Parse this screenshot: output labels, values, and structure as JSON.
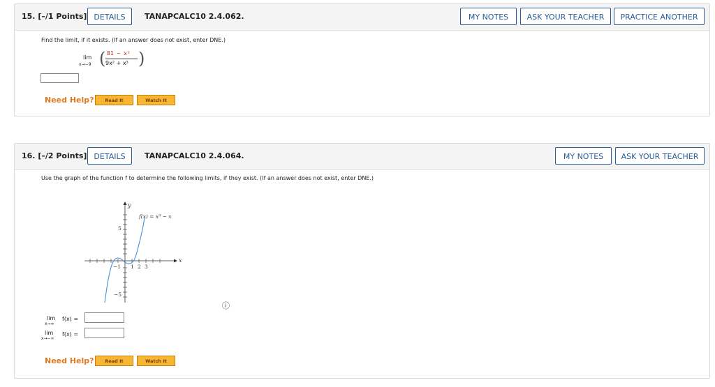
{
  "q15": {
    "number": "15.",
    "points": "[–/1 Points]",
    "details": "DETAILS",
    "code": "TANAPCALC10 2.4.062.",
    "my_notes": "MY NOTES",
    "ask_teacher": "ASK YOUR TEACHER",
    "practice": "PRACTICE ANOTHER",
    "prompt": "Find the limit, if it exists. (If an answer does not exist, enter DNE.)",
    "lim": "lim",
    "lim_sub": "x→−9",
    "numerator": "81 − x²",
    "denominator": "9x² + x³",
    "answer_value": "",
    "need_help": "Need Help?",
    "read_it": "Read It",
    "watch_it": "Watch It"
  },
  "q16": {
    "number": "16.",
    "points": "[–/2 Points]",
    "details": "DETAILS",
    "code": "TANAPCALC10 2.4.064.",
    "my_notes": "MY NOTES",
    "ask_teacher": "ASK YOUR TEACHER",
    "prompt": "Use the graph of the function f to determine the following limits, if they exist. (If an answer does not exist, enter DNE.)",
    "graph": {
      "y_label": "y",
      "x_label": "x",
      "func_label": "f(x) = x³ − x",
      "tick_y_pos": "5",
      "tick_y_neg": "−5",
      "tick_x_neg1": "−1",
      "tick_x_1": "1",
      "tick_x_2": "2",
      "tick_x_3": "3"
    },
    "info_icon": "ⓘ",
    "lim1": "lim",
    "lim1_sub": "x→∞",
    "lim1_expr": "f(x) =",
    "lim2": "lim",
    "lim2_sub": "x→−∞",
    "lim2_expr": "f(x) =",
    "answer1": "",
    "answer2": "",
    "need_help": "Need Help?",
    "read_it": "Read It",
    "watch_it": "Watch It"
  },
  "colors": {
    "accent": "#2a5c95",
    "help": "#e07a1f",
    "help_btn": "#f7b733",
    "curve": "#4a8fd6"
  }
}
